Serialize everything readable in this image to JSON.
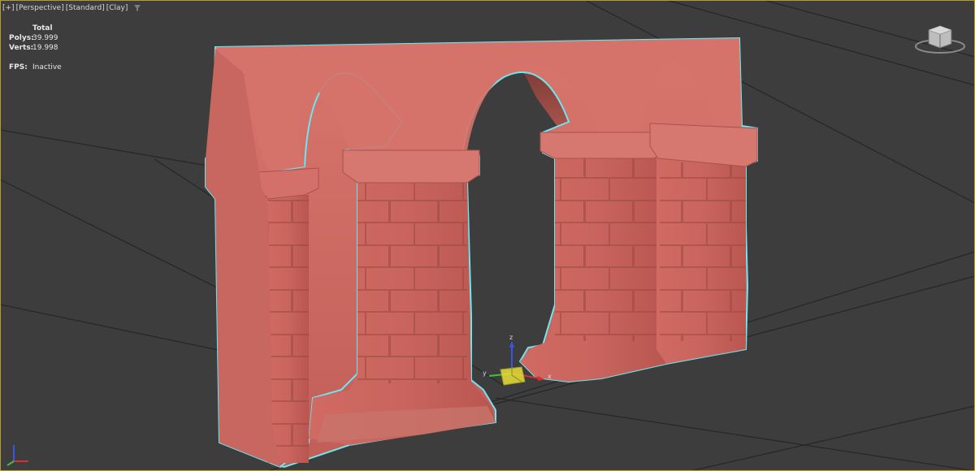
{
  "viewport": {
    "labels": [
      "[+]",
      "[Perspective]",
      "[Standard]",
      "[Clay]"
    ],
    "filter_icon": "funnel-icon"
  },
  "stats": {
    "header": "Total",
    "polys_label": "Polys:",
    "polys_value": "39.999",
    "verts_label": "Verts:",
    "verts_value": "19.998",
    "fps_label": "FPS:",
    "fps_value": "Inactive"
  },
  "gizmo": {
    "x_label": "x",
    "y_label": "y",
    "z_label": "z"
  },
  "colors": {
    "background": "#3d3d3d",
    "grid": "#262626",
    "model_fill": "#c96a62",
    "selection_outline": "#6ee6f0",
    "gizmo_yellow": "#e8e03a",
    "axis_red": "#d83030",
    "axis_blue": "#3a55e0",
    "axis_green": "#40c040"
  }
}
